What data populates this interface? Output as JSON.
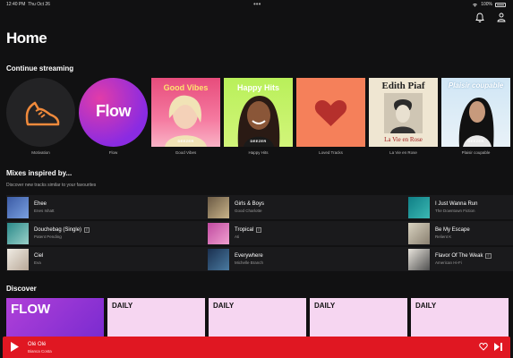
{
  "status": {
    "time": "12:40 PM",
    "date": "Thu Oct 26",
    "dots": "•••",
    "battery": "100%"
  },
  "header": {
    "title": "Home"
  },
  "continue_streaming": {
    "title": "Continue streaming",
    "items": [
      {
        "caption": "Motivation",
        "art_text": ""
      },
      {
        "caption": "Flow",
        "art_text": "Flow"
      },
      {
        "caption": "Good Vibes",
        "art_text": "Good Vibes"
      },
      {
        "caption": "Happy Hits",
        "art_text": "Happy Hits"
      },
      {
        "caption": "Loved Tracks",
        "art_text": ""
      },
      {
        "caption": "La Vie en Rose",
        "art_text": "Edith Piaf",
        "art_subtext": "La Vie en Rose"
      },
      {
        "caption": "Plaisir coupable",
        "art_text": "Plaisir coupable"
      }
    ],
    "brand_mark": "DEEZER"
  },
  "mixes": {
    "title": "Mixes inspired by...",
    "subtitle": "Discover new tracks similar to your favourites",
    "items": [
      {
        "title": "Ehee",
        "artist": "Enes Ishatt",
        "explicit": false
      },
      {
        "title": "Girls & Boys",
        "artist": "Good Charlotte",
        "explicit": false
      },
      {
        "title": "I Just Wanna Run",
        "artist": "The Downtown Fiction",
        "explicit": false
      },
      {
        "title": "Douchebag (Single)",
        "artist": "Patent Pending",
        "explicit": true
      },
      {
        "title": "Tropical",
        "artist": "Ati",
        "explicit": true
      },
      {
        "title": "Be My Escape",
        "artist": "Relient K",
        "explicit": false
      },
      {
        "title": "Ciel",
        "artist": "Eva",
        "explicit": false
      },
      {
        "title": "Everywhere",
        "artist": "Michelle Branch",
        "explicit": false
      },
      {
        "title": "Flavor Of The Weak",
        "artist": "American Hi-Fi",
        "explicit": true
      }
    ],
    "explicit_label": "E"
  },
  "discover": {
    "title": "Discover",
    "cards": [
      {
        "label": "FLOW"
      },
      {
        "label": "DAILY"
      },
      {
        "label": "DAILY"
      },
      {
        "label": "DAILY"
      },
      {
        "label": "DAILY"
      }
    ]
  },
  "player": {
    "title": "Olé Olé",
    "artist": "Bianca Costa"
  },
  "colors": {
    "accent": "#e01722",
    "flow": "#a43be0",
    "daily": "#f6d6f1"
  }
}
